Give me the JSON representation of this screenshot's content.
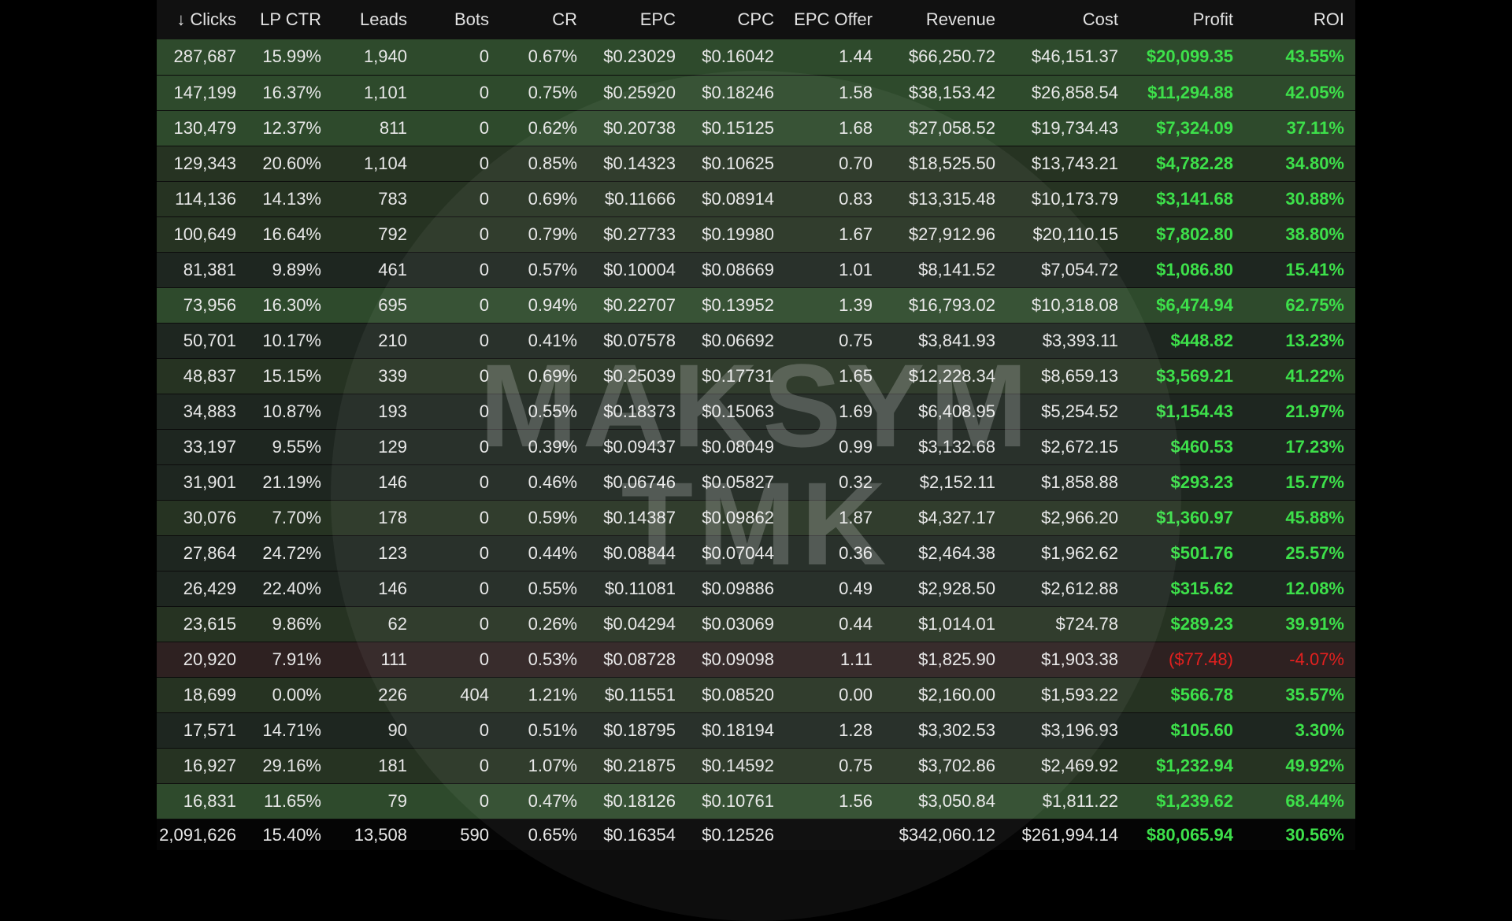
{
  "table": {
    "sort_arrow": "↓",
    "columns": [
      "Clicks",
      "LP CTR",
      "Leads",
      "Bots",
      "CR",
      "EPC",
      "CPC",
      "EPC Offer",
      "Revenue",
      "Cost",
      "Profit",
      "ROI"
    ],
    "rows": [
      {
        "tone": "pos",
        "cells": [
          "287,687",
          "15.99%",
          "1,940",
          "0",
          "0.67%",
          "$0.23029",
          "$0.16042",
          "1.44",
          "$66,250.72",
          "$46,151.37",
          "$20,099.35",
          "43.55%"
        ]
      },
      {
        "tone": "pos",
        "cells": [
          "147,199",
          "16.37%",
          "1,101",
          "0",
          "0.75%",
          "$0.25920",
          "$0.18246",
          "1.58",
          "$38,153.42",
          "$26,858.54",
          "$11,294.88",
          "42.05%"
        ]
      },
      {
        "tone": "pos",
        "cells": [
          "130,479",
          "12.37%",
          "811",
          "0",
          "0.62%",
          "$0.20738",
          "$0.15125",
          "1.68",
          "$27,058.52",
          "$19,734.43",
          "$7,324.09",
          "37.11%"
        ]
      },
      {
        "tone": "mid",
        "cells": [
          "129,343",
          "20.60%",
          "1,104",
          "0",
          "0.85%",
          "$0.14323",
          "$0.10625",
          "0.70",
          "$18,525.50",
          "$13,743.21",
          "$4,782.28",
          "34.80%"
        ]
      },
      {
        "tone": "mid",
        "cells": [
          "114,136",
          "14.13%",
          "783",
          "0",
          "0.69%",
          "$0.11666",
          "$0.08914",
          "0.83",
          "$13,315.48",
          "$10,173.79",
          "$3,141.68",
          "30.88%"
        ]
      },
      {
        "tone": "mid",
        "cells": [
          "100,649",
          "16.64%",
          "792",
          "0",
          "0.79%",
          "$0.27733",
          "$0.19980",
          "1.67",
          "$27,912.96",
          "$20,110.15",
          "$7,802.80",
          "38.80%"
        ]
      },
      {
        "tone": "low",
        "cells": [
          "81,381",
          "9.89%",
          "461",
          "0",
          "0.57%",
          "$0.10004",
          "$0.08669",
          "1.01",
          "$8,141.52",
          "$7,054.72",
          "$1,086.80",
          "15.41%"
        ]
      },
      {
        "tone": "pos",
        "cells": [
          "73,956",
          "16.30%",
          "695",
          "0",
          "0.94%",
          "$0.22707",
          "$0.13952",
          "1.39",
          "$16,793.02",
          "$10,318.08",
          "$6,474.94",
          "62.75%"
        ]
      },
      {
        "tone": "low",
        "cells": [
          "50,701",
          "10.17%",
          "210",
          "0",
          "0.41%",
          "$0.07578",
          "$0.06692",
          "0.75",
          "$3,841.93",
          "$3,393.11",
          "$448.82",
          "13.23%"
        ]
      },
      {
        "tone": "mid",
        "cells": [
          "48,837",
          "15.15%",
          "339",
          "0",
          "0.69%",
          "$0.25039",
          "$0.17731",
          "1.65",
          "$12,228.34",
          "$8,659.13",
          "$3,569.21",
          "41.22%"
        ]
      },
      {
        "tone": "low",
        "cells": [
          "34,883",
          "10.87%",
          "193",
          "0",
          "0.55%",
          "$0.18373",
          "$0.15063",
          "1.69",
          "$6,408.95",
          "$5,254.52",
          "$1,154.43",
          "21.97%"
        ]
      },
      {
        "tone": "low",
        "cells": [
          "33,197",
          "9.55%",
          "129",
          "0",
          "0.39%",
          "$0.09437",
          "$0.08049",
          "0.99",
          "$3,132.68",
          "$2,672.15",
          "$460.53",
          "17.23%"
        ]
      },
      {
        "tone": "low",
        "cells": [
          "31,901",
          "21.19%",
          "146",
          "0",
          "0.46%",
          "$0.06746",
          "$0.05827",
          "0.32",
          "$2,152.11",
          "$1,858.88",
          "$293.23",
          "15.77%"
        ]
      },
      {
        "tone": "mid",
        "cells": [
          "30,076",
          "7.70%",
          "178",
          "0",
          "0.59%",
          "$0.14387",
          "$0.09862",
          "1.87",
          "$4,327.17",
          "$2,966.20",
          "$1,360.97",
          "45.88%"
        ]
      },
      {
        "tone": "low",
        "cells": [
          "27,864",
          "24.72%",
          "123",
          "0",
          "0.44%",
          "$0.08844",
          "$0.07044",
          "0.36",
          "$2,464.38",
          "$1,962.62",
          "$501.76",
          "25.57%"
        ]
      },
      {
        "tone": "low",
        "cells": [
          "26,429",
          "22.40%",
          "146",
          "0",
          "0.55%",
          "$0.11081",
          "$0.09886",
          "0.49",
          "$2,928.50",
          "$2,612.88",
          "$315.62",
          "12.08%"
        ]
      },
      {
        "tone": "mid",
        "cells": [
          "23,615",
          "9.86%",
          "62",
          "0",
          "0.26%",
          "$0.04294",
          "$0.03069",
          "0.44",
          "$1,014.01",
          "$724.78",
          "$289.23",
          "39.91%"
        ]
      },
      {
        "tone": "neg",
        "cells": [
          "20,920",
          "7.91%",
          "111",
          "0",
          "0.53%",
          "$0.08728",
          "$0.09098",
          "1.11",
          "$1,825.90",
          "$1,903.38",
          "($77.48)",
          "-4.07%"
        ]
      },
      {
        "tone": "mid",
        "cells": [
          "18,699",
          "0.00%",
          "226",
          "404",
          "1.21%",
          "$0.11551",
          "$0.08520",
          "0.00",
          "$2,160.00",
          "$1,593.22",
          "$566.78",
          "35.57%"
        ]
      },
      {
        "tone": "low",
        "cells": [
          "17,571",
          "14.71%",
          "90",
          "0",
          "0.51%",
          "$0.18795",
          "$0.18194",
          "1.28",
          "$3,302.53",
          "$3,196.93",
          "$105.60",
          "3.30%"
        ]
      },
      {
        "tone": "mid",
        "cells": [
          "16,927",
          "29.16%",
          "181",
          "0",
          "1.07%",
          "$0.21875",
          "$0.14592",
          "0.75",
          "$3,702.86",
          "$2,469.92",
          "$1,232.94",
          "49.92%"
        ]
      },
      {
        "tone": "pos",
        "cells": [
          "16,831",
          "11.65%",
          "79",
          "0",
          "0.47%",
          "$0.18126",
          "$0.10761",
          "1.56",
          "$3,050.84",
          "$1,811.22",
          "$1,239.62",
          "68.44%"
        ]
      }
    ],
    "totals": [
      "2,091,626",
      "15.40%",
      "13,508",
      "590",
      "0.65%",
      "$0.16354",
      "$0.12526",
      "",
      "$342,060.12",
      "$261,994.14",
      "$80,065.94",
      "30.56%"
    ]
  },
  "watermark": {
    "line1": "MAKSYM",
    "line2": "TMK"
  },
  "colors": {
    "profit_positive": "#3de04a",
    "profit_negative": "#e2201f",
    "row_positive": "#2e4a2c",
    "row_negative": "#2e2121"
  }
}
